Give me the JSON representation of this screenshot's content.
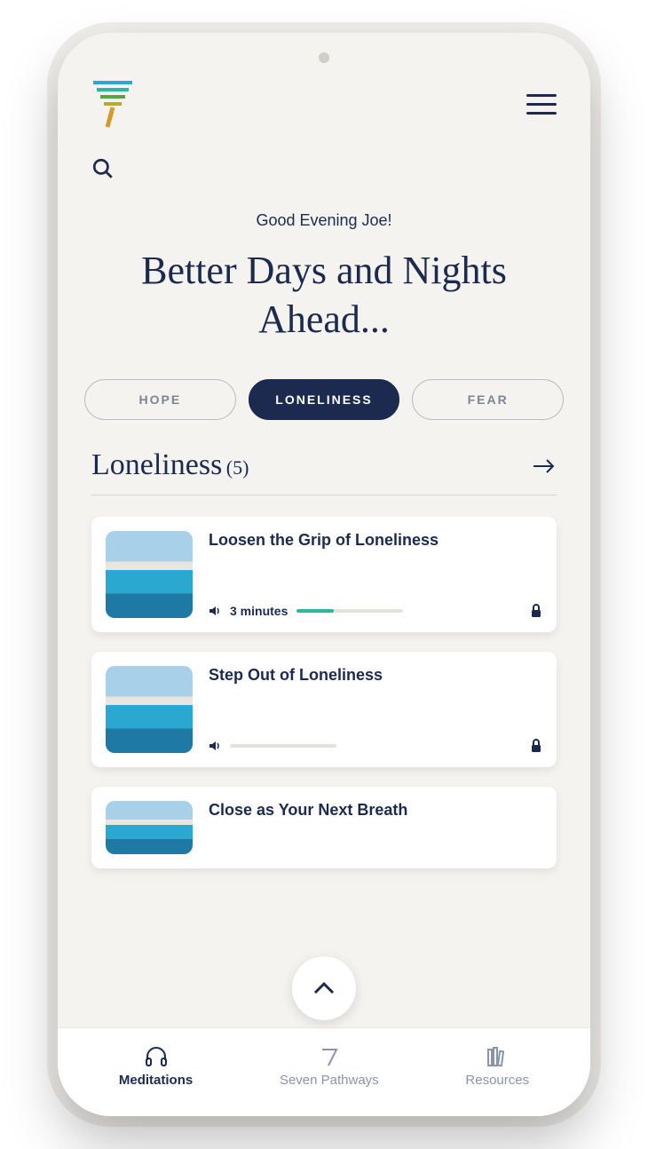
{
  "colors": {
    "primary": "#1b2a4e",
    "accent": "#2ab8a5",
    "surface": "#f5f3f0"
  },
  "header": {
    "logo_name": "seven-logo"
  },
  "hero": {
    "greeting": "Good Evening Joe!",
    "headline": "Better Days and Nights Ahead..."
  },
  "chips": [
    {
      "label": "HOPE",
      "active": false
    },
    {
      "label": "LONELINESS",
      "active": true
    },
    {
      "label": "FEAR",
      "active": false
    }
  ],
  "section": {
    "title": "Loneliness",
    "count_label": "(5)"
  },
  "cards": [
    {
      "title": "Loosen the Grip of Loneliness",
      "duration": "3 minutes",
      "progress": 35,
      "locked": true
    },
    {
      "title": "Step Out of Loneliness",
      "duration": "",
      "progress": 0,
      "locked": true
    },
    {
      "title": "Close as Your Next Breath",
      "duration": "",
      "progress": 0,
      "locked": false
    }
  ],
  "tabs": [
    {
      "icon": "headphones",
      "label": "Meditations",
      "active": true
    },
    {
      "icon": "seven",
      "label": "Seven Pathways",
      "active": false
    },
    {
      "icon": "books",
      "label": "Resources",
      "active": false
    }
  ]
}
